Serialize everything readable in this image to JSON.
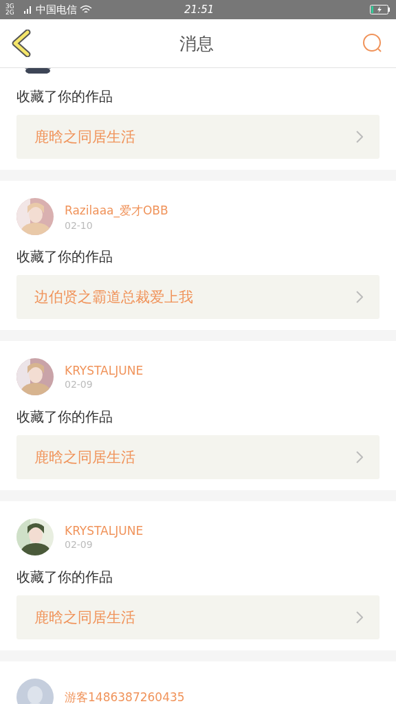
{
  "status_bar": {
    "network": "3G 2G",
    "carrier": "中国电信",
    "time": "21:51"
  },
  "header": {
    "title": "消息"
  },
  "messages": [
    {
      "kind": "partial",
      "action": "收藏了你的作品",
      "work": "鹿晗之同居生活"
    },
    {
      "kind": "full",
      "user": "Razilaaa_爱才OBB",
      "date": "02-10",
      "action": "收藏了你的作品",
      "work": "边伯贤之霸道总裁爱上我"
    },
    {
      "kind": "full",
      "user": "KRYSTALJUNE",
      "date": "02-09",
      "action": "收藏了你的作品",
      "work": "鹿晗之同居生活"
    },
    {
      "kind": "full",
      "user": "KRYSTALJUNE",
      "date": "02-09",
      "action": "收藏了你的作品",
      "work": "鹿晗之同居生活"
    },
    {
      "kind": "guest",
      "user": "游客1486387260435"
    }
  ]
}
